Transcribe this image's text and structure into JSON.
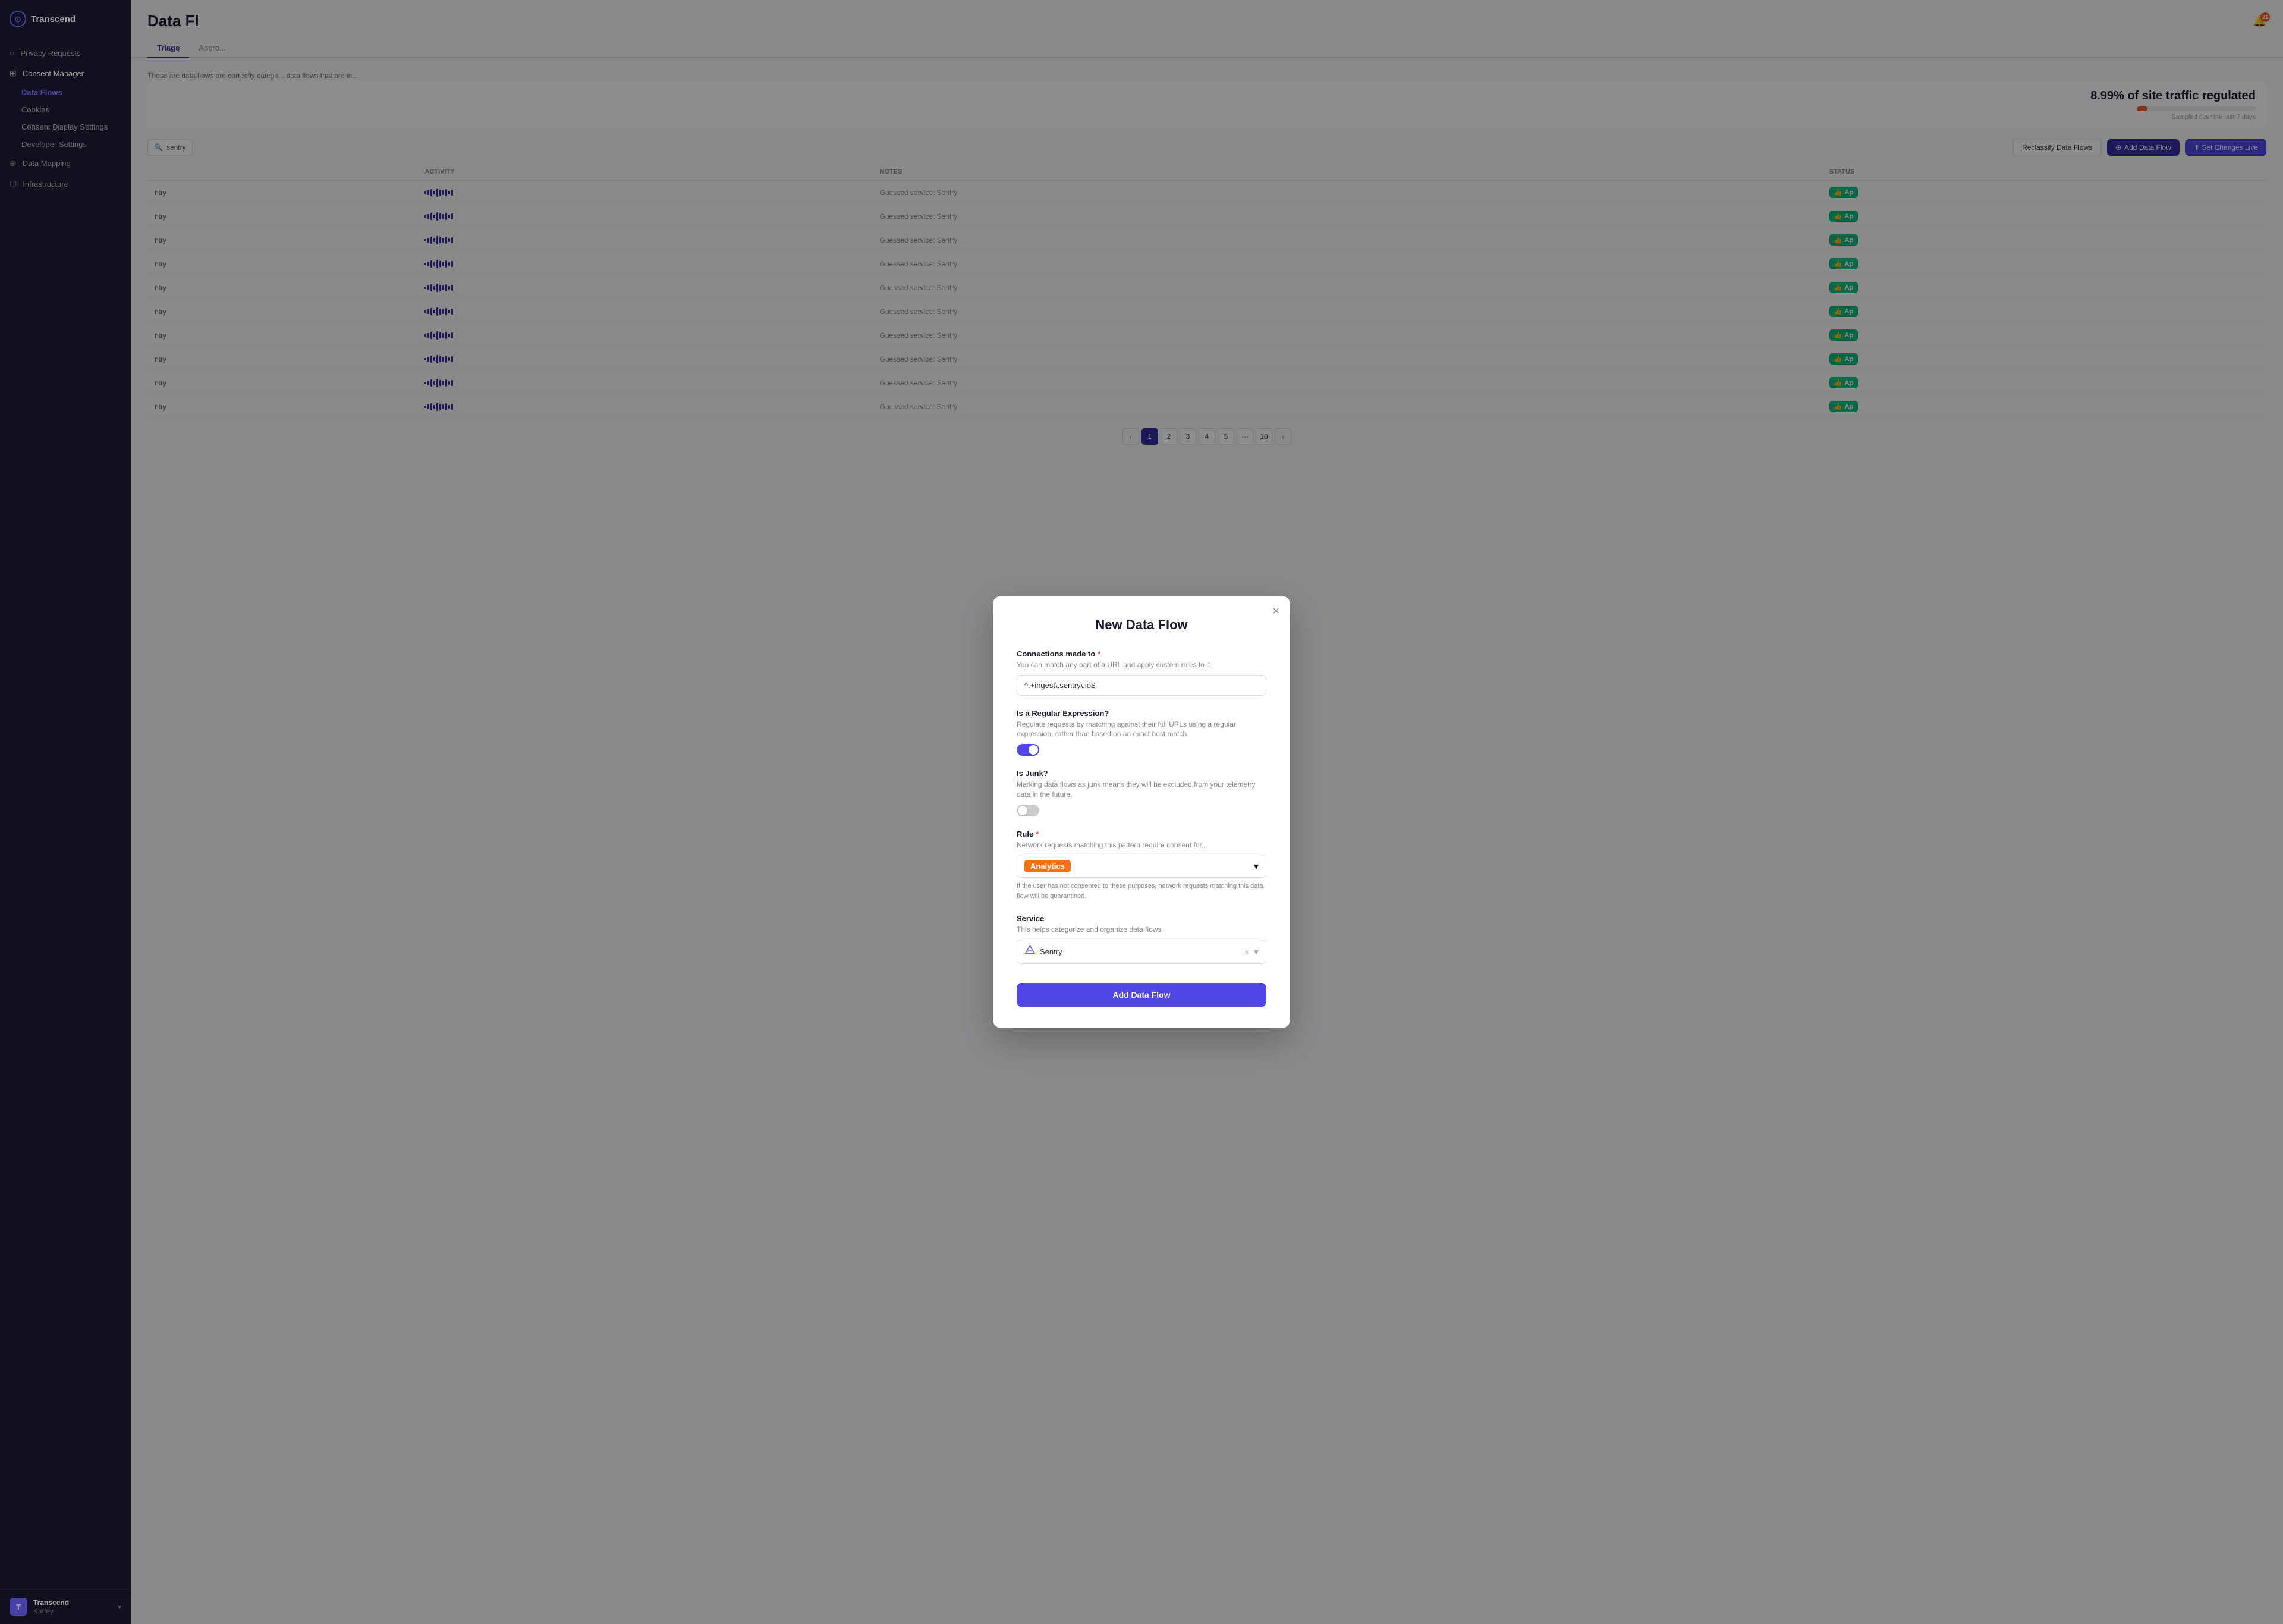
{
  "app": {
    "name": "Transcend"
  },
  "sidebar": {
    "logo_initial": "⊙",
    "items": [
      {
        "id": "privacy-requests",
        "label": "Privacy Requests",
        "icon": "○"
      },
      {
        "id": "consent-manager",
        "label": "Consent Manager",
        "icon": "⊞"
      },
      {
        "id": "data-flows",
        "label": "Data Flows",
        "icon": null,
        "active": true
      },
      {
        "id": "cookies",
        "label": "Cookies",
        "icon": null
      },
      {
        "id": "consent-display",
        "label": "Consent Display Settings",
        "icon": null
      },
      {
        "id": "developer-settings",
        "label": "Developer Settings",
        "icon": null
      },
      {
        "id": "data-mapping",
        "label": "Data Mapping",
        "icon": "⊕"
      },
      {
        "id": "infrastructure",
        "label": "Infrastructure",
        "icon": "⬡"
      }
    ],
    "user": {
      "name": "Transcend",
      "role": "Karley",
      "avatar_initial": "T"
    }
  },
  "header": {
    "title": "Data Fl",
    "notification_count": "21"
  },
  "tabs": [
    {
      "id": "triage",
      "label": "Triage",
      "active": true
    },
    {
      "id": "approved",
      "label": "Appro...",
      "active": false
    }
  ],
  "description": "These are data flows are correctly catego... data flows that are in...",
  "traffic": {
    "stat": "8.99% of site traffic regulated",
    "progress": 9,
    "sample_label": "Sampled over the last 7 days"
  },
  "toolbar": {
    "search_placeholder": "sentry",
    "reclassify_label": "Reclassify Data Flows",
    "add_label": "Add Data Flow",
    "set_live_label": "⬆ Set Changes Live"
  },
  "table": {
    "columns": [
      "ACTIVITY",
      "NOTES",
      "STATUS"
    ],
    "rows": [
      {
        "name": "ntry",
        "notes": "Guessed service: Sentry",
        "status": "Ap"
      },
      {
        "name": "ntry",
        "notes": "Guessed service: Sentry",
        "status": "Ap"
      },
      {
        "name": "ntry",
        "notes": "Guessed service: Sentry",
        "status": "Ap"
      },
      {
        "name": "ntry",
        "notes": "Guessed service: Sentry",
        "status": "Ap"
      },
      {
        "name": "ntry",
        "notes": "Guessed service: Sentry",
        "status": "Ap"
      },
      {
        "name": "ntry",
        "notes": "Guessed service: Sentry",
        "status": "Ap"
      },
      {
        "name": "ntry",
        "notes": "Guessed service: Sentry",
        "status": "Ap"
      },
      {
        "name": "ntry",
        "notes": "Guessed service: Sentry",
        "status": "Ap"
      },
      {
        "name": "ntry",
        "notes": "Guessed service: Sentry",
        "status": "Ap"
      },
      {
        "name": "ntry",
        "notes": "Guessed service: Sentry",
        "status": "Ap"
      }
    ]
  },
  "pagination": {
    "pages": [
      "1",
      "2",
      "3",
      "4",
      "5",
      "...",
      "10"
    ],
    "active_page": "1"
  },
  "modal": {
    "title": "New Data Flow",
    "close_label": "×",
    "connections_label": "Connections made to",
    "connections_required": true,
    "connections_desc": "You can match any part of a URL and apply custom rules to it",
    "connections_value": "^.+ingest\\.sentry\\.io$",
    "regex_label": "Is a Regular Expression?",
    "regex_desc": "Regulate requests by matching against their full URLs using a regular expression, rather than based on an exact host match.",
    "regex_enabled": true,
    "junk_label": "Is Junk?",
    "junk_desc": "Marking data flows as junk means they will be excluded from your telemetry data in the future.",
    "junk_enabled": false,
    "rule_label": "Rule",
    "rule_required": true,
    "rule_desc": "Network requests matching this pattern require consent for...",
    "rule_value": "Analytics",
    "rule_hint": "If the user has not consented to these purposes, network requests matching this data flow will be quarantined.",
    "service_label": "Service",
    "service_desc": "This helps categorize and organize data flows",
    "service_value": "Sentry",
    "submit_label": "Add Data Flow"
  }
}
